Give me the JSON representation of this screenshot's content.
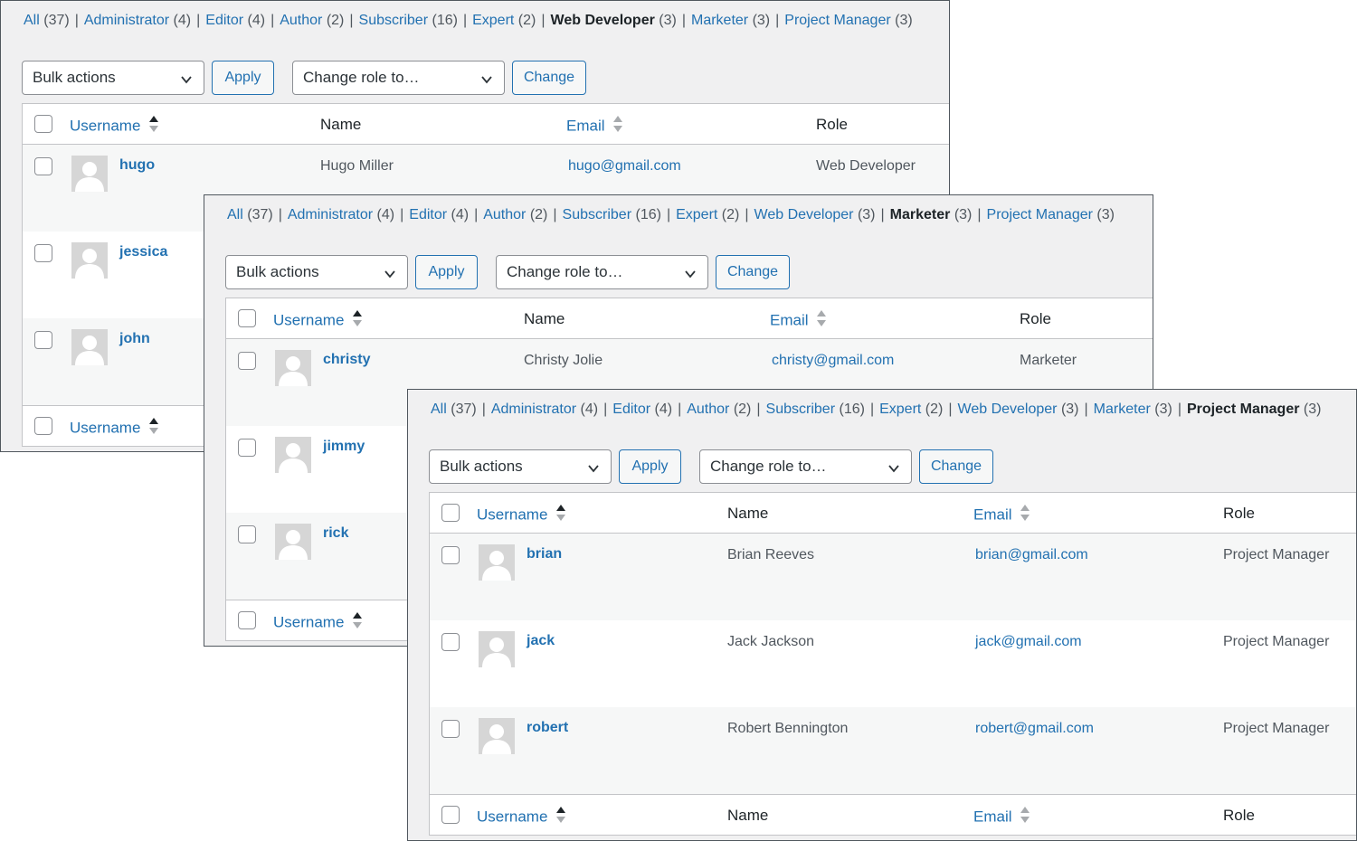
{
  "filters": [
    {
      "label": "All",
      "count": "(37)"
    },
    {
      "label": "Administrator",
      "count": "(4)"
    },
    {
      "label": "Editor",
      "count": "(4)"
    },
    {
      "label": "Author",
      "count": "(2)"
    },
    {
      "label": "Subscriber",
      "count": "(16)"
    },
    {
      "label": "Expert",
      "count": "(2)"
    },
    {
      "label": "Web Developer",
      "count": "(3)"
    },
    {
      "label": "Marketer",
      "count": "(3)"
    },
    {
      "label": "Project Manager",
      "count": "(3)"
    }
  ],
  "separator": "|",
  "toolbar": {
    "bulk_actions": "Bulk actions",
    "apply": "Apply",
    "change_role": "Change role to…",
    "change": "Change"
  },
  "columns": {
    "username": "Username",
    "name": "Name",
    "email": "Email",
    "role": "Role"
  },
  "panels": [
    {
      "current_filter": "Web Developer",
      "users": [
        {
          "username": "hugo",
          "name": "Hugo Miller",
          "email": "hugo@gmail.com",
          "role": "Web Developer"
        },
        {
          "username": "jessica",
          "name": "",
          "email": "",
          "role": ""
        },
        {
          "username": "john",
          "name": "",
          "email": "",
          "role": ""
        }
      ]
    },
    {
      "current_filter": "Marketer",
      "users": [
        {
          "username": "christy",
          "name": "Christy Jolie",
          "email": "christy@gmail.com",
          "role": "Marketer"
        },
        {
          "username": "jimmy",
          "name": "",
          "email": "",
          "role": ""
        },
        {
          "username": "rick",
          "name": "",
          "email": "",
          "role": ""
        }
      ]
    },
    {
      "current_filter": "Project Manager",
      "users": [
        {
          "username": "brian",
          "name": "Brian Reeves",
          "email": "brian@gmail.com",
          "role": "Project Manager"
        },
        {
          "username": "jack",
          "name": "Jack Jackson",
          "email": "jack@gmail.com",
          "role": "Project Manager"
        },
        {
          "username": "robert",
          "name": "Robert Bennington",
          "email": "robert@gmail.com",
          "role": "Project Manager"
        }
      ]
    }
  ],
  "colors": {
    "link": "#2271b1",
    "text": "#3c434a",
    "panel_bg": "#f0f0f1",
    "row_alt": "#f6f7f7"
  }
}
